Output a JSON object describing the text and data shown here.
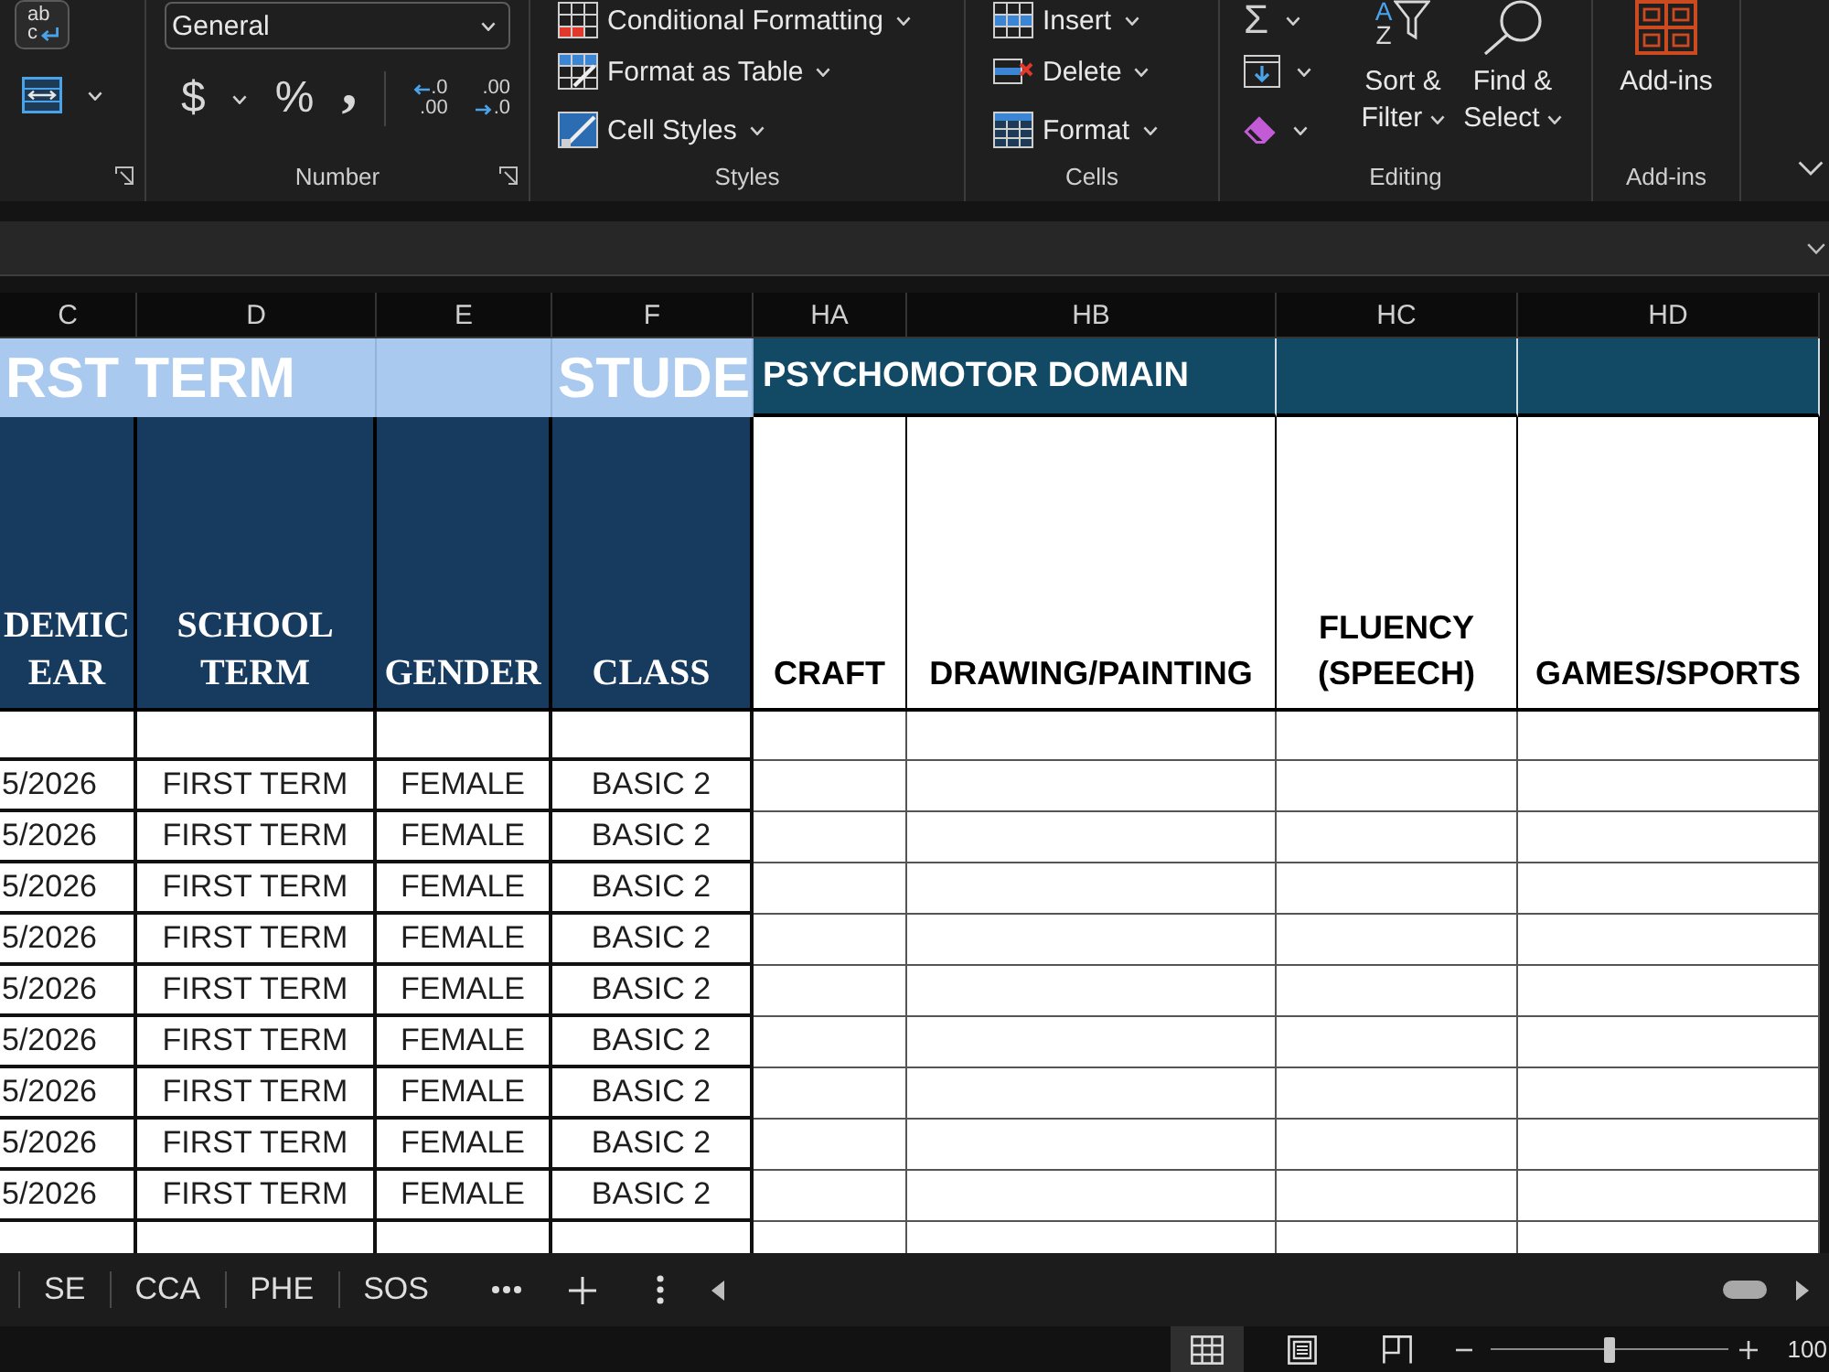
{
  "ribbon": {
    "groups": [
      {
        "kind": "alignment",
        "wrap_glyph": [
          "ab",
          "c"
        ]
      },
      {
        "kind": "number",
        "label": "Number",
        "format": "General",
        "symbols": [
          "$",
          "%",
          ","
        ],
        "decimals": [
          {
            "top": ".0",
            "bottom": ".00"
          },
          {
            "top": ".00",
            "bottom": ".0"
          }
        ]
      },
      {
        "kind": "styles",
        "label": "Styles",
        "buttons": [
          "Conditional Formatting",
          "Format as Table",
          "Cell Styles"
        ]
      },
      {
        "kind": "cells",
        "label": "Cells",
        "buttons": [
          "Insert",
          "Delete",
          "Format"
        ]
      },
      {
        "kind": "editing",
        "label": "Editing",
        "sum_glyph": "Σ",
        "sort_glyph": [
          "A",
          "Z"
        ],
        "buttons": [
          "Sort & Filter",
          "Find & Select"
        ]
      },
      {
        "kind": "addins",
        "label": "Add-ins",
        "buttons": [
          "Add-ins"
        ]
      }
    ]
  },
  "sheet": {
    "columns": [
      "C",
      "D",
      "E",
      "F",
      "HA",
      "HB",
      "HC",
      "HD"
    ],
    "title_row": [
      {
        "kind": "banner",
        "text": "RST TERM",
        "color": "#a9c9ee",
        "merged": true
      },
      {
        "kind": "banner",
        "color": "#a9c9ee"
      },
      {
        "kind": "banner",
        "text": "STUDE",
        "color": "#a9c9ee"
      },
      {
        "kind": "section",
        "text": "PSYCHOMOTOR DOMAIN",
        "color": "#124a66",
        "merged": true
      },
      {
        "kind": "section",
        "color": "#124a66"
      },
      {
        "kind": "section",
        "color": "#124a66"
      }
    ],
    "header_row": [
      {
        "text": "DEMIC EAR",
        "color": "#173a5f"
      },
      {
        "text": "SCHOOL TERM",
        "color": "#173a5f"
      },
      {
        "text": "GENDER",
        "color": "#173a5f"
      },
      {
        "text": "CLASS",
        "color": "#173a5f"
      },
      {
        "text": "CRAFT",
        "color": "#ffffff"
      },
      {
        "text": "DRAWING/PAINTING",
        "color": "#ffffff"
      },
      {
        "text": "FLUENCY (SPEECH)",
        "color": "#ffffff"
      },
      {
        "text": "GAMES/SPORTS",
        "color": "#ffffff"
      }
    ],
    "rows": [
      [
        "5/2026",
        "FIRST TERM",
        "FEMALE",
        "BASIC 2"
      ],
      [
        "5/2026",
        "FIRST TERM",
        "FEMALE",
        "BASIC 2"
      ],
      [
        "5/2026",
        "FIRST TERM",
        "FEMALE",
        "BASIC 2"
      ],
      [
        "5/2026",
        "FIRST TERM",
        "FEMALE",
        "BASIC 2"
      ],
      [
        "5/2026",
        "FIRST TERM",
        "FEMALE",
        "BASIC 2"
      ],
      [
        "5/2026",
        "FIRST TERM",
        "FEMALE",
        "BASIC 2"
      ],
      [
        "5/2026",
        "FIRST TERM",
        "FEMALE",
        "BASIC 2"
      ],
      [
        "5/2026",
        "FIRST TERM",
        "FEMALE",
        "BASIC 2"
      ],
      [
        "5/2026",
        "FIRST TERM",
        "FEMALE",
        "BASIC 2"
      ]
    ]
  },
  "sheet_tabs": [
    {
      "label": "SE"
    },
    {
      "label": "CCA"
    },
    {
      "label": "PHE"
    },
    {
      "label": "SOS"
    }
  ],
  "status_bar": {
    "views": [
      {
        "selected": true
      },
      {
        "selected": false
      },
      {
        "selected": false
      }
    ],
    "zoom": {
      "level": 0.5,
      "reading": "100"
    }
  }
}
